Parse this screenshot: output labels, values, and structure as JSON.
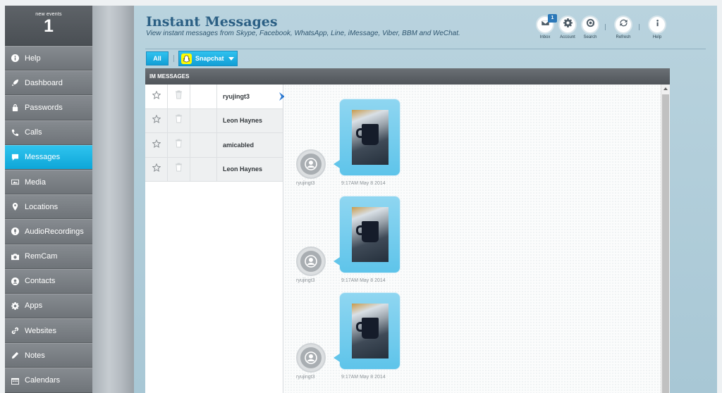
{
  "events": {
    "label": "new events",
    "count": "1"
  },
  "nav": [
    {
      "label": "Help",
      "icon": "info-icon"
    },
    {
      "label": "Dashboard",
      "icon": "rocket-icon"
    },
    {
      "label": "Passwords",
      "icon": "lock-icon"
    },
    {
      "label": "Calls",
      "icon": "phone-icon"
    },
    {
      "label": "Messages",
      "icon": "chat-bubble-icon",
      "active": true
    },
    {
      "label": "Media",
      "icon": "image-icon"
    },
    {
      "label": "Locations",
      "icon": "map-pin-icon"
    },
    {
      "label": "AudioRecordings",
      "icon": "microphone-icon"
    },
    {
      "label": "RemCam",
      "icon": "camera-icon"
    },
    {
      "label": "Contacts",
      "icon": "contact-icon"
    },
    {
      "label": "Apps",
      "icon": "gear-icon"
    },
    {
      "label": "Websites",
      "icon": "link-icon"
    },
    {
      "label": "Notes",
      "icon": "pencil-icon"
    },
    {
      "label": "Calendars",
      "icon": "calendar-icon"
    }
  ],
  "header": {
    "title": "Instant Messages",
    "subtitle": "View instant messages from Skype, Facebook, WhatsApp, Line, iMessage, Viber, BBM and WeChat."
  },
  "toolbar": {
    "inbox": "Inbox",
    "inbox_badge": "1",
    "account": "Account",
    "search": "Search",
    "refresh": "Refresh",
    "help": "Help"
  },
  "filters": {
    "all": "All",
    "app": "Snapchat"
  },
  "panel": {
    "heading": "IM MESSAGES"
  },
  "conversations": [
    {
      "name": "ryujingt3",
      "selected": true
    },
    {
      "name": "Leon Haynes"
    },
    {
      "name": "amicabled"
    },
    {
      "name": "Leon Haynes"
    }
  ],
  "messages": [
    {
      "from": "ryujingt3",
      "time": "9:17AM May 8 2014"
    },
    {
      "from": "ryujingt3",
      "time": "9:17AM May 8 2014"
    },
    {
      "from": "ryujingt3",
      "time": "9:17AM May 8 2014"
    }
  ],
  "colors": {
    "accent": "#129fd6",
    "title": "#2b5f84",
    "snapchat": "#fffc00"
  }
}
